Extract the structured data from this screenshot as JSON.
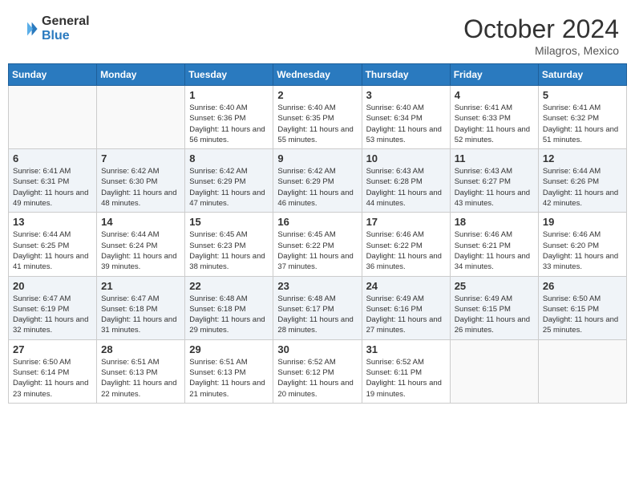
{
  "header": {
    "logo_line1": "General",
    "logo_line2": "Blue",
    "month": "October 2024",
    "location": "Milagros, Mexico"
  },
  "weekdays": [
    "Sunday",
    "Monday",
    "Tuesday",
    "Wednesday",
    "Thursday",
    "Friday",
    "Saturday"
  ],
  "weeks": [
    [
      {
        "day": "",
        "sunrise": "",
        "sunset": "",
        "daylight": ""
      },
      {
        "day": "",
        "sunrise": "",
        "sunset": "",
        "daylight": ""
      },
      {
        "day": "1",
        "sunrise": "Sunrise: 6:40 AM",
        "sunset": "Sunset: 6:36 PM",
        "daylight": "Daylight: 11 hours and 56 minutes."
      },
      {
        "day": "2",
        "sunrise": "Sunrise: 6:40 AM",
        "sunset": "Sunset: 6:35 PM",
        "daylight": "Daylight: 11 hours and 55 minutes."
      },
      {
        "day": "3",
        "sunrise": "Sunrise: 6:40 AM",
        "sunset": "Sunset: 6:34 PM",
        "daylight": "Daylight: 11 hours and 53 minutes."
      },
      {
        "day": "4",
        "sunrise": "Sunrise: 6:41 AM",
        "sunset": "Sunset: 6:33 PM",
        "daylight": "Daylight: 11 hours and 52 minutes."
      },
      {
        "day": "5",
        "sunrise": "Sunrise: 6:41 AM",
        "sunset": "Sunset: 6:32 PM",
        "daylight": "Daylight: 11 hours and 51 minutes."
      }
    ],
    [
      {
        "day": "6",
        "sunrise": "Sunrise: 6:41 AM",
        "sunset": "Sunset: 6:31 PM",
        "daylight": "Daylight: 11 hours and 49 minutes."
      },
      {
        "day": "7",
        "sunrise": "Sunrise: 6:42 AM",
        "sunset": "Sunset: 6:30 PM",
        "daylight": "Daylight: 11 hours and 48 minutes."
      },
      {
        "day": "8",
        "sunrise": "Sunrise: 6:42 AM",
        "sunset": "Sunset: 6:29 PM",
        "daylight": "Daylight: 11 hours and 47 minutes."
      },
      {
        "day": "9",
        "sunrise": "Sunrise: 6:42 AM",
        "sunset": "Sunset: 6:29 PM",
        "daylight": "Daylight: 11 hours and 46 minutes."
      },
      {
        "day": "10",
        "sunrise": "Sunrise: 6:43 AM",
        "sunset": "Sunset: 6:28 PM",
        "daylight": "Daylight: 11 hours and 44 minutes."
      },
      {
        "day": "11",
        "sunrise": "Sunrise: 6:43 AM",
        "sunset": "Sunset: 6:27 PM",
        "daylight": "Daylight: 11 hours and 43 minutes."
      },
      {
        "day": "12",
        "sunrise": "Sunrise: 6:44 AM",
        "sunset": "Sunset: 6:26 PM",
        "daylight": "Daylight: 11 hours and 42 minutes."
      }
    ],
    [
      {
        "day": "13",
        "sunrise": "Sunrise: 6:44 AM",
        "sunset": "Sunset: 6:25 PM",
        "daylight": "Daylight: 11 hours and 41 minutes."
      },
      {
        "day": "14",
        "sunrise": "Sunrise: 6:44 AM",
        "sunset": "Sunset: 6:24 PM",
        "daylight": "Daylight: 11 hours and 39 minutes."
      },
      {
        "day": "15",
        "sunrise": "Sunrise: 6:45 AM",
        "sunset": "Sunset: 6:23 PM",
        "daylight": "Daylight: 11 hours and 38 minutes."
      },
      {
        "day": "16",
        "sunrise": "Sunrise: 6:45 AM",
        "sunset": "Sunset: 6:22 PM",
        "daylight": "Daylight: 11 hours and 37 minutes."
      },
      {
        "day": "17",
        "sunrise": "Sunrise: 6:46 AM",
        "sunset": "Sunset: 6:22 PM",
        "daylight": "Daylight: 11 hours and 36 minutes."
      },
      {
        "day": "18",
        "sunrise": "Sunrise: 6:46 AM",
        "sunset": "Sunset: 6:21 PM",
        "daylight": "Daylight: 11 hours and 34 minutes."
      },
      {
        "day": "19",
        "sunrise": "Sunrise: 6:46 AM",
        "sunset": "Sunset: 6:20 PM",
        "daylight": "Daylight: 11 hours and 33 minutes."
      }
    ],
    [
      {
        "day": "20",
        "sunrise": "Sunrise: 6:47 AM",
        "sunset": "Sunset: 6:19 PM",
        "daylight": "Daylight: 11 hours and 32 minutes."
      },
      {
        "day": "21",
        "sunrise": "Sunrise: 6:47 AM",
        "sunset": "Sunset: 6:18 PM",
        "daylight": "Daylight: 11 hours and 31 minutes."
      },
      {
        "day": "22",
        "sunrise": "Sunrise: 6:48 AM",
        "sunset": "Sunset: 6:18 PM",
        "daylight": "Daylight: 11 hours and 29 minutes."
      },
      {
        "day": "23",
        "sunrise": "Sunrise: 6:48 AM",
        "sunset": "Sunset: 6:17 PM",
        "daylight": "Daylight: 11 hours and 28 minutes."
      },
      {
        "day": "24",
        "sunrise": "Sunrise: 6:49 AM",
        "sunset": "Sunset: 6:16 PM",
        "daylight": "Daylight: 11 hours and 27 minutes."
      },
      {
        "day": "25",
        "sunrise": "Sunrise: 6:49 AM",
        "sunset": "Sunset: 6:15 PM",
        "daylight": "Daylight: 11 hours and 26 minutes."
      },
      {
        "day": "26",
        "sunrise": "Sunrise: 6:50 AM",
        "sunset": "Sunset: 6:15 PM",
        "daylight": "Daylight: 11 hours and 25 minutes."
      }
    ],
    [
      {
        "day": "27",
        "sunrise": "Sunrise: 6:50 AM",
        "sunset": "Sunset: 6:14 PM",
        "daylight": "Daylight: 11 hours and 23 minutes."
      },
      {
        "day": "28",
        "sunrise": "Sunrise: 6:51 AM",
        "sunset": "Sunset: 6:13 PM",
        "daylight": "Daylight: 11 hours and 22 minutes."
      },
      {
        "day": "29",
        "sunrise": "Sunrise: 6:51 AM",
        "sunset": "Sunset: 6:13 PM",
        "daylight": "Daylight: 11 hours and 21 minutes."
      },
      {
        "day": "30",
        "sunrise": "Sunrise: 6:52 AM",
        "sunset": "Sunset: 6:12 PM",
        "daylight": "Daylight: 11 hours and 20 minutes."
      },
      {
        "day": "31",
        "sunrise": "Sunrise: 6:52 AM",
        "sunset": "Sunset: 6:11 PM",
        "daylight": "Daylight: 11 hours and 19 minutes."
      },
      {
        "day": "",
        "sunrise": "",
        "sunset": "",
        "daylight": ""
      },
      {
        "day": "",
        "sunrise": "",
        "sunset": "",
        "daylight": ""
      }
    ]
  ]
}
